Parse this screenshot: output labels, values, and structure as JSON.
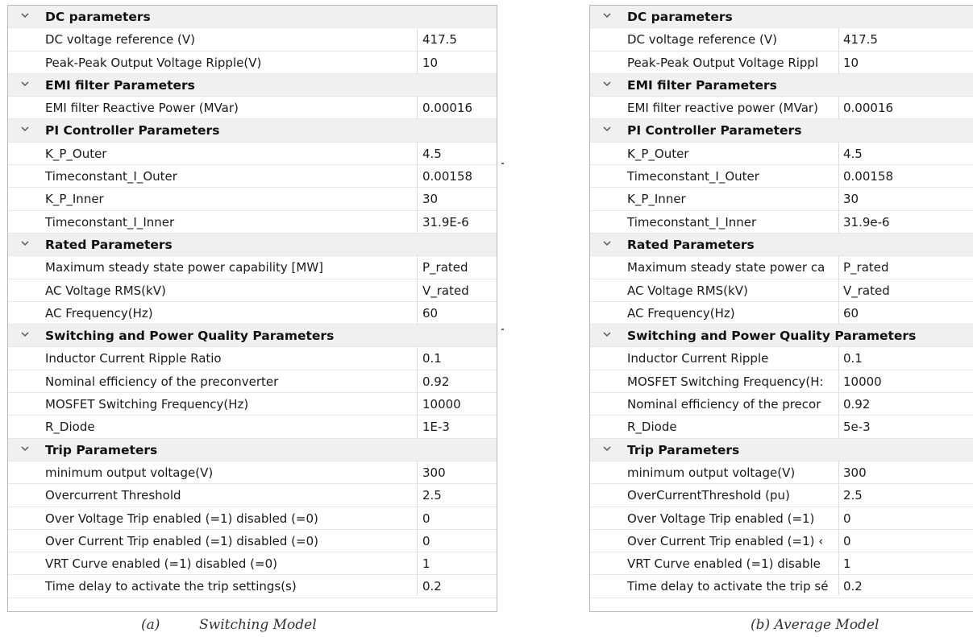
{
  "panels": [
    {
      "sections": [
        {
          "title": "DC parameters",
          "rows": [
            {
              "name": "DC voltage reference (V)",
              "value": "417.5"
            },
            {
              "name": "Peak-Peak Output Voltage Ripple(V)",
              "value": "10"
            }
          ]
        },
        {
          "title": "EMI filter Parameters",
          "rows": [
            {
              "name": "EMI filter Reactive Power (MVar)",
              "value": "0.00016"
            }
          ]
        },
        {
          "title": "PI Controller Parameters",
          "rows": [
            {
              "name": "K_P_Outer",
              "value": "4.5"
            },
            {
              "name": "Timeconstant_I_Outer",
              "value": "0.00158"
            },
            {
              "name": "K_P_Inner",
              "value": "30"
            },
            {
              "name": "Timeconstant_I_Inner",
              "value": "31.9E-6"
            }
          ]
        },
        {
          "title": "Rated Parameters",
          "rows": [
            {
              "name": "Maximum steady state power capability [MW]",
              "value": "P_rated"
            },
            {
              "name": "AC  Voltage RMS(kV)",
              "value": "V_rated"
            },
            {
              "name": "AC  Frequency(Hz)",
              "value": "60"
            }
          ]
        },
        {
          "title": "Switching and Power Quality Parameters",
          "rows": [
            {
              "name": "Inductor Current Ripple Ratio",
              "value": "0.1"
            },
            {
              "name": "Nominal efficiency of the preconverter",
              "value": "0.92"
            },
            {
              "name": "MOSFET Switching Frequency(Hz)",
              "value": "10000"
            },
            {
              "name": "R_Diode",
              "value": "1E-3"
            }
          ]
        },
        {
          "title": "Trip Parameters",
          "rows": [
            {
              "name": "minimum output voltage(V)",
              "value": "300"
            },
            {
              "name": "Overcurrent Threshold",
              "value": "2.5"
            },
            {
              "name": "Over Voltage Trip enabled (=1) disabled (=0)",
              "value": "0"
            },
            {
              "name": "Over Current Trip enabled (=1) disabled (=0)",
              "value": "0"
            },
            {
              "name": "VRT Curve enabled (=1) disabled (=0)",
              "value": "1"
            },
            {
              "name": "Time delay to activate the trip settings(s)",
              "value": "0.2"
            }
          ]
        }
      ]
    },
    {
      "sections": [
        {
          "title": "DC parameters",
          "rows": [
            {
              "name": "DC voltage reference (V)",
              "value": "417.5"
            },
            {
              "name": "Peak-Peak Output Voltage Rippl",
              "value": "10"
            }
          ]
        },
        {
          "title": "EMI filter Parameters",
          "rows": [
            {
              "name": "EMI filter reactive power (MVar)",
              "value": "0.00016"
            }
          ]
        },
        {
          "title": "PI Controller Parameters",
          "rows": [
            {
              "name": "K_P_Outer",
              "value": "4.5"
            },
            {
              "name": "Timeconstant_I_Outer",
              "value": "0.00158"
            },
            {
              "name": "K_P_Inner",
              "value": "30"
            },
            {
              "name": "Timeconstant_I_Inner",
              "value": "31.9e-6"
            }
          ]
        },
        {
          "title": "Rated Parameters",
          "rows": [
            {
              "name": "Maximum steady state power ca",
              "value": "P_rated"
            },
            {
              "name": "AC  Voltage RMS(kV)",
              "value": "V_rated"
            },
            {
              "name": "AC  Frequency(Hz)",
              "value": "60"
            }
          ]
        },
        {
          "title": "Switching and Power Quality Parameters",
          "rows": [
            {
              "name": "Inductor Current Ripple",
              "value": "0.1"
            },
            {
              "name": "MOSFET Switching Frequency(H:",
              "value": "10000"
            },
            {
              "name": "Nominal efficiency of the precor",
              "value": "0.92"
            },
            {
              "name": "R_Diode",
              "value": "5e-3"
            }
          ]
        },
        {
          "title": "Trip Parameters",
          "rows": [
            {
              "name": "minimum output voltage(V)",
              "value": "300"
            },
            {
              "name": "OverCurrentThreshold (pu)",
              "value": "2.5"
            },
            {
              "name": "Over Voltage Trip enabled (=1)",
              "value": "0"
            },
            {
              "name": "Over Current Trip enabled (=1) ‹",
              "value": "0"
            },
            {
              "name": "VRT Curve enabled (=1) disable",
              "value": "1"
            },
            {
              "name": "Time delay to activate the trip sé",
              "value": "0.2"
            }
          ]
        }
      ]
    }
  ],
  "captions": {
    "a": "(a)         Switching Model",
    "b": "(b) Average Model"
  },
  "icons": {
    "section_toggle": "chevron-down-icon"
  },
  "colors": {
    "category_bg": "#f0f0f0",
    "accent": "#2f7fd3"
  }
}
